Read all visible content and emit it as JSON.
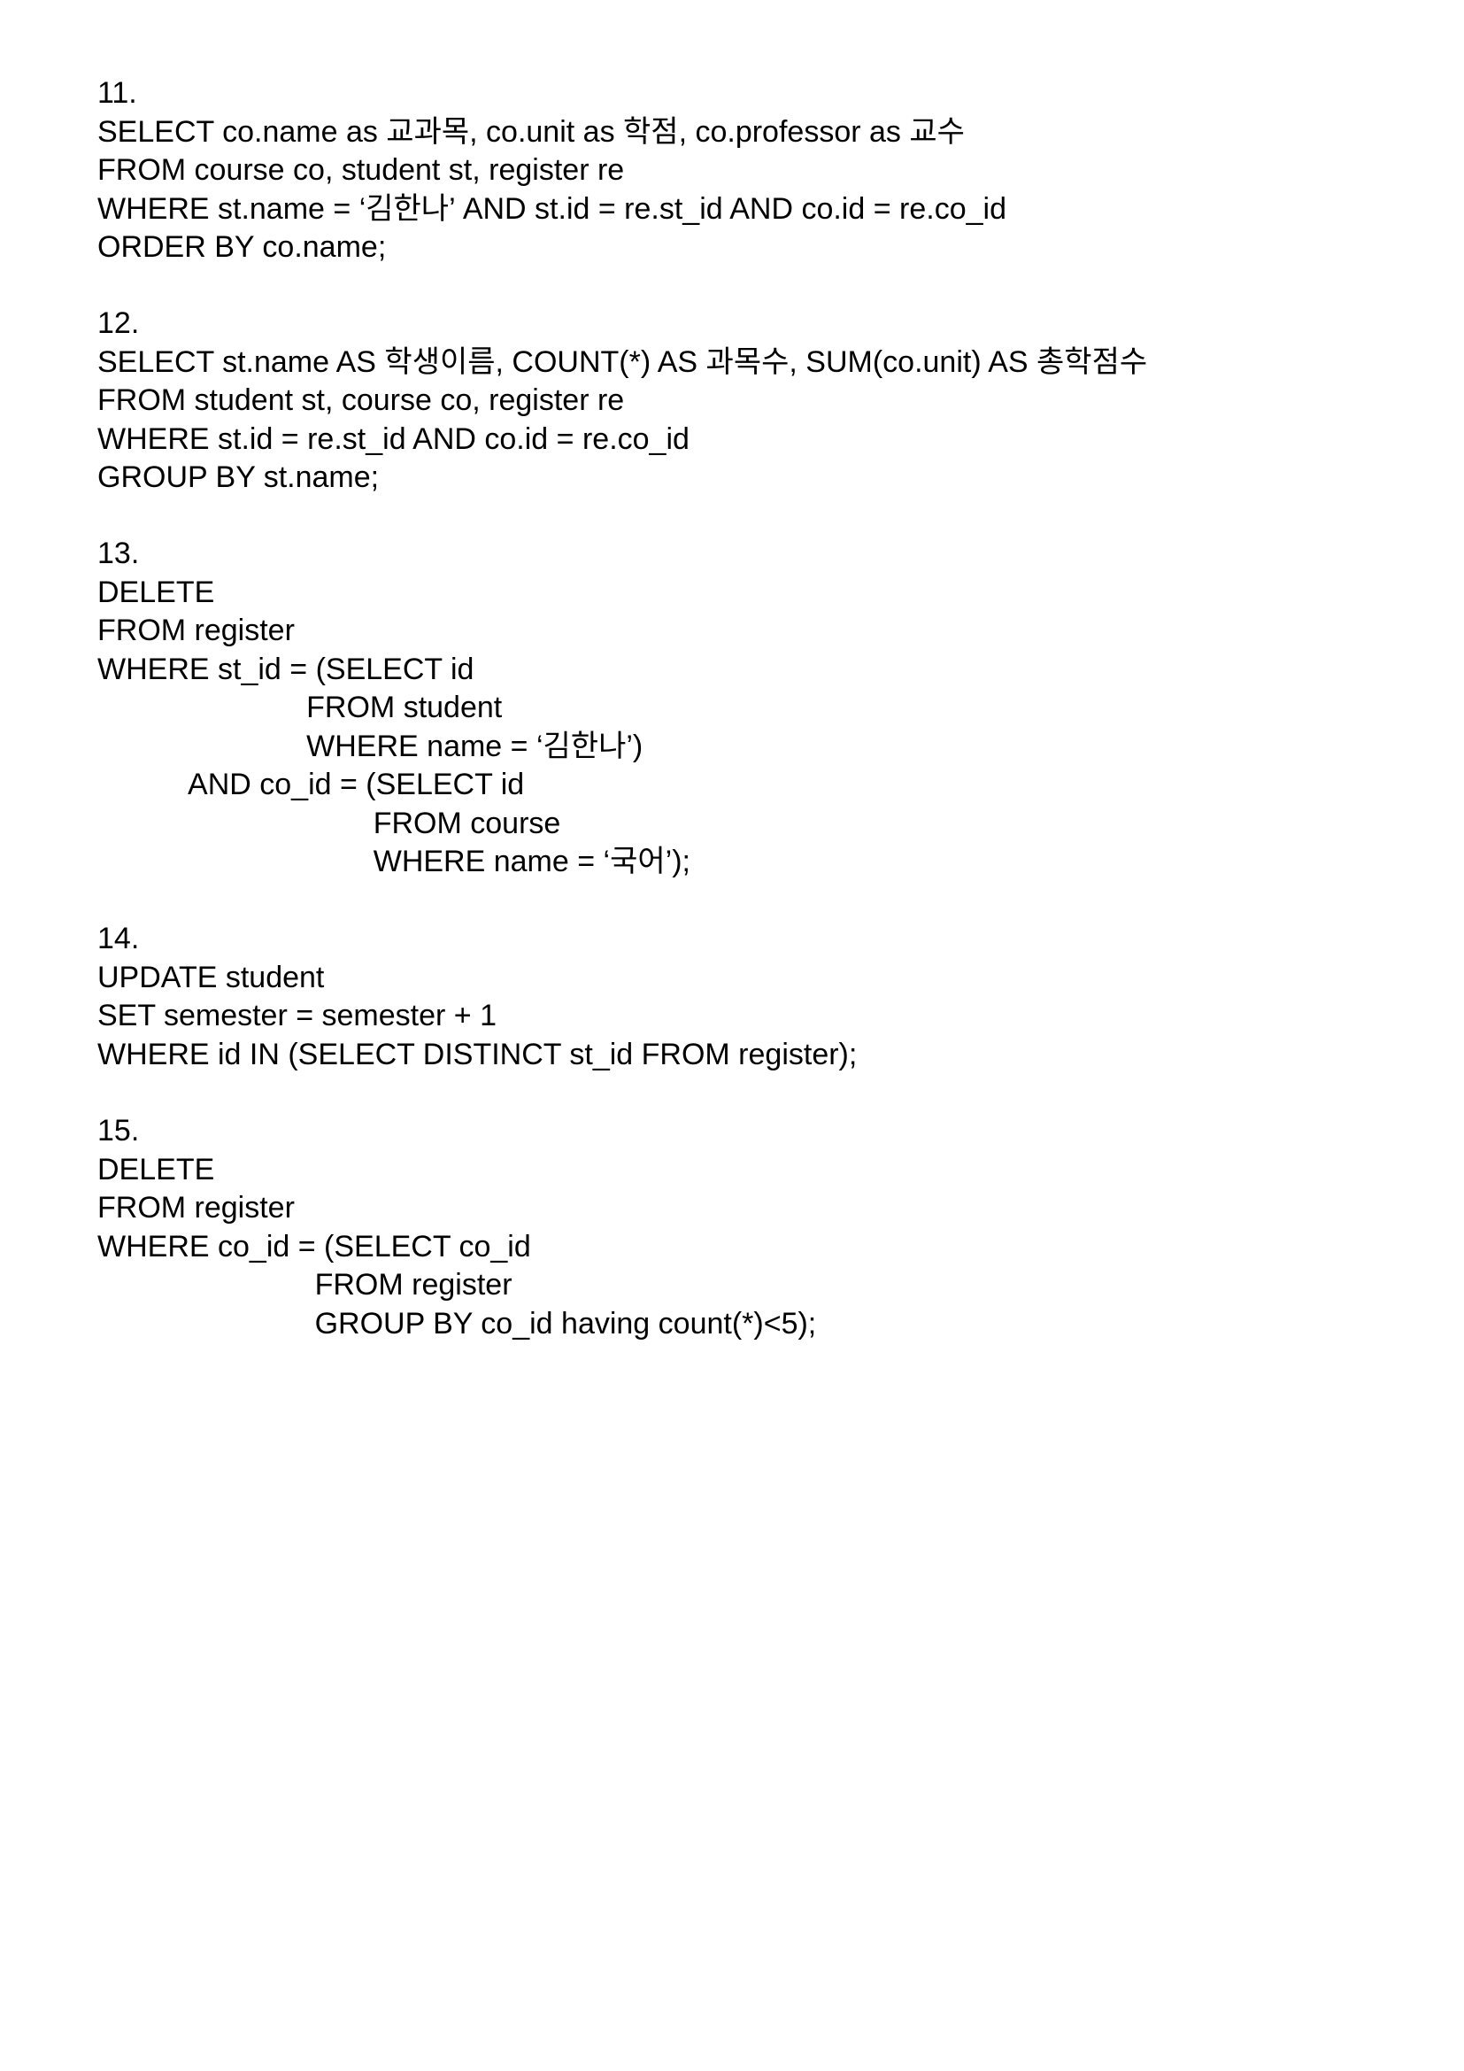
{
  "blocks": [
    {
      "number": "11.",
      "lines": [
        "SELECT co.name as 교과목, co.unit as 학점, co.professor as 교수",
        "FROM course co, student st, register re",
        "WHERE st.name = ‘김한나’ AND st.id = re.st_id AND co.id = re.co_id",
        "ORDER BY co.name;"
      ]
    },
    {
      "number": "12.",
      "lines": [
        "SELECT st.name AS 학생이름, COUNT(*) AS 과목수, SUM(co.unit) AS 총학점수",
        "FROM student st, course co, register re",
        "WHERE st.id = re.st_id AND co.id = re.co_id",
        "GROUP BY st.name;"
      ]
    },
    {
      "number": "13.",
      "lines": [
        "DELETE",
        "FROM register",
        "WHERE st_id = (SELECT id",
        "                         FROM student",
        "                         WHERE name = ‘김한나’)",
        "           AND co_id = (SELECT id",
        "                                 FROM course",
        "                                 WHERE name = ‘국어’);"
      ]
    },
    {
      "number": "14.",
      "lines": [
        "UPDATE student",
        "SET semester = semester + 1",
        "WHERE id IN (SELECT DISTINCT st_id FROM register);"
      ]
    },
    {
      "number": "15.",
      "lines": [
        "DELETE",
        "FROM register",
        "WHERE co_id = (SELECT co_id",
        "                          FROM register",
        "                          GROUP BY co_id having count(*)<5);"
      ]
    }
  ]
}
